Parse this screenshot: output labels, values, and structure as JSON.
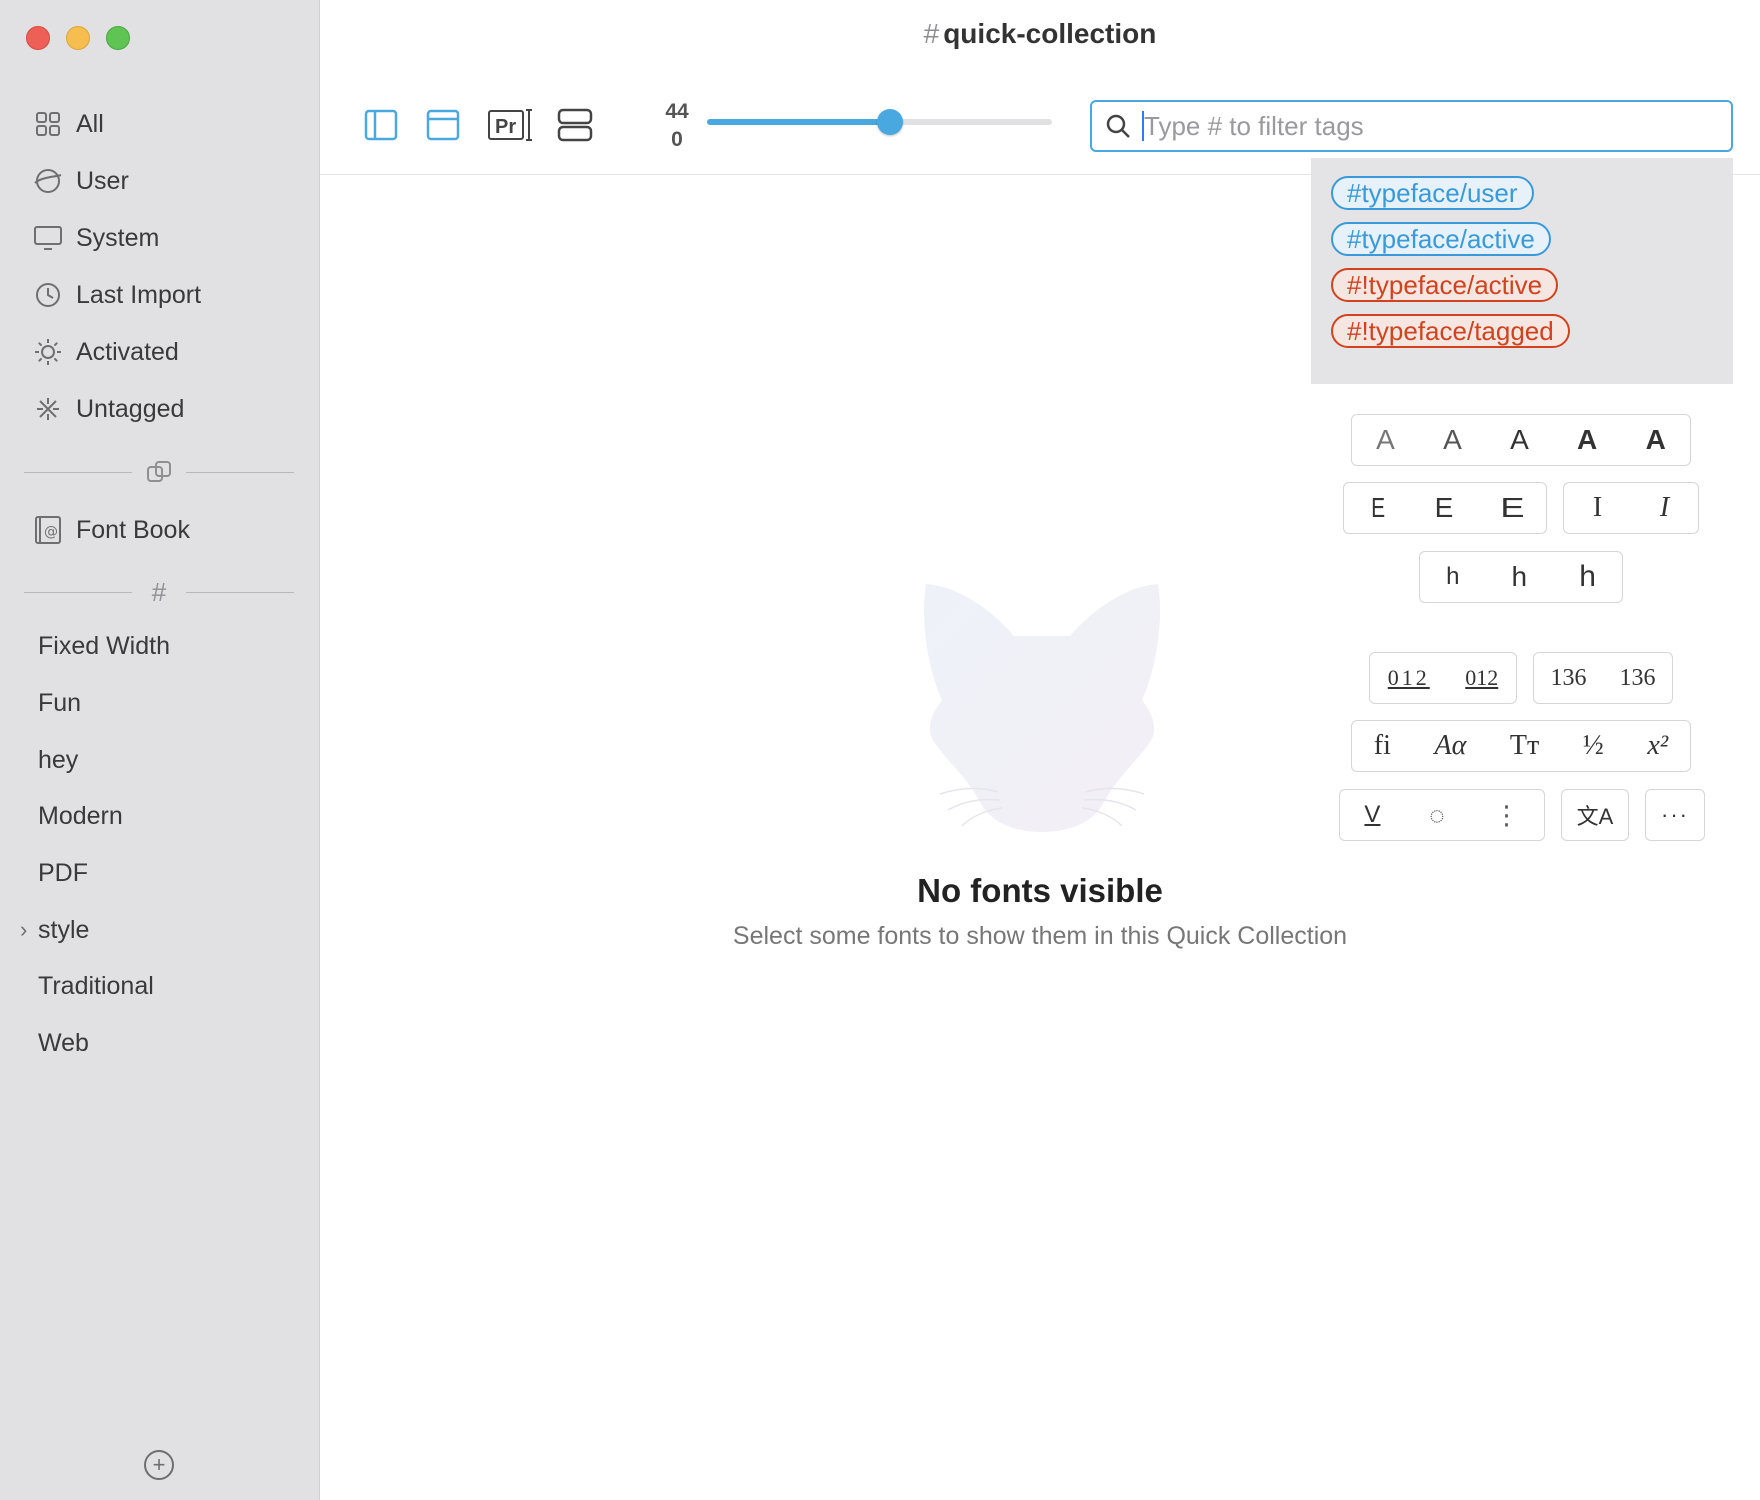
{
  "window": {
    "title": "quick-collection",
    "title_prefix": "#"
  },
  "sidebar": {
    "items": [
      {
        "label": "All",
        "icon": "grid-icon"
      },
      {
        "label": "User",
        "icon": "globe-icon"
      },
      {
        "label": "System",
        "icon": "display-icon"
      },
      {
        "label": "Last Import",
        "icon": "clock-icon"
      },
      {
        "label": "Activated",
        "icon": "sun-icon"
      },
      {
        "label": "Untagged",
        "icon": "sparkle-off-icon"
      }
    ],
    "library": {
      "label": "Font Book",
      "icon": "font-book-icon"
    },
    "tags": [
      "Fixed Width",
      "Fun",
      "hey",
      "Modern",
      "PDF",
      "style",
      "Traditional",
      "Web"
    ],
    "collapsed_disclosure": "›",
    "tags_divider": "#"
  },
  "toolbar": {
    "size_top": "44",
    "size_bottom": "0",
    "size_slider_fraction": 0.53,
    "search_placeholder": "Type # to filter tags"
  },
  "tag_suggestions": [
    {
      "label": "#typeface/user",
      "kind": "include"
    },
    {
      "label": "#typeface/active",
      "kind": "include"
    },
    {
      "label": "#!typeface/active",
      "kind": "exclude"
    },
    {
      "label": "#!typeface/tagged",
      "kind": "exclude"
    }
  ],
  "feature_panel": {
    "weights": [
      "A",
      "A",
      "A",
      "A",
      "A"
    ],
    "widths": [
      "E",
      "E",
      "E"
    ],
    "slants": [
      "I",
      "I"
    ],
    "xheights": [
      "h",
      "h",
      "h"
    ],
    "figures_a": [
      "012",
      "012"
    ],
    "figures_b": [
      "136",
      "136"
    ],
    "features": [
      "fi",
      "Aα",
      "Tт",
      "½",
      "x²"
    ],
    "misc": [
      "V",
      "◌",
      "⋮"
    ],
    "lang": "文A",
    "more": "···"
  },
  "empty_state": {
    "title": "No fonts visible",
    "subtitle": "Select some fonts to show them in this Quick Collection"
  },
  "colors": {
    "accent": "#4aa8e0",
    "include_tag": "#3a9ad8",
    "exclude_tag": "#d0431e"
  }
}
